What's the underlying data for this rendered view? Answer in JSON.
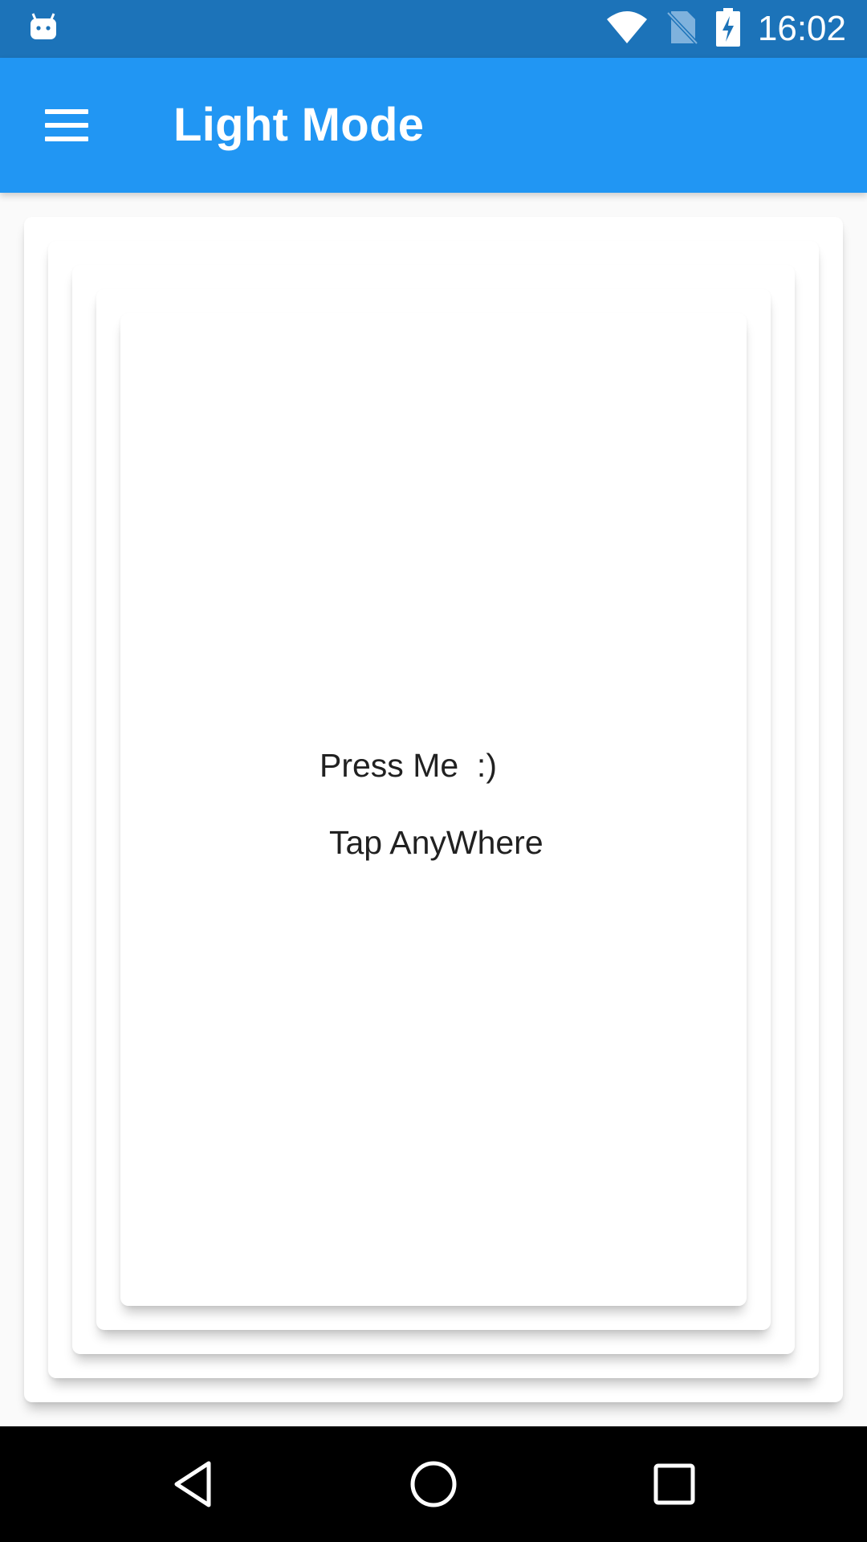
{
  "status_bar": {
    "time": "16:02",
    "icons": [
      "android-notification-icon",
      "wifi-icon",
      "no-sim-icon",
      "battery-charging-icon"
    ],
    "background": "#1c73b9"
  },
  "app_bar": {
    "title": "Light Mode",
    "menu_icon": "hamburger-menu-icon",
    "background": "#2196f3"
  },
  "content": {
    "press_label": "Press Me  :)",
    "tap_label": "Tap AnyWhere"
  },
  "nav_bar": {
    "icons": [
      "back-icon",
      "home-icon",
      "recents-icon"
    ],
    "background": "#000000"
  }
}
